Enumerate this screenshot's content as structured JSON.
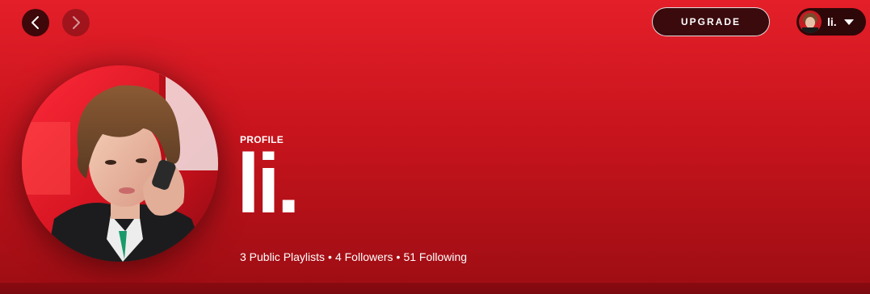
{
  "nav": {
    "back_icon": "chevron-left-icon",
    "forward_icon": "chevron-right-icon"
  },
  "upgrade": {
    "label": "UPGRADE"
  },
  "user_menu": {
    "name": "li.",
    "caret_icon": "caret-down-icon"
  },
  "profile": {
    "type_label": "PROFILE",
    "name": "li.",
    "stats": {
      "playlists": "3 Public Playlists",
      "followers": "4 Followers",
      "following": "51 Following",
      "separator": "•"
    }
  },
  "colors": {
    "header_top": "#e41f29",
    "header_bottom": "#9c0d13",
    "upgrade_bg": "#3a0a0d"
  }
}
